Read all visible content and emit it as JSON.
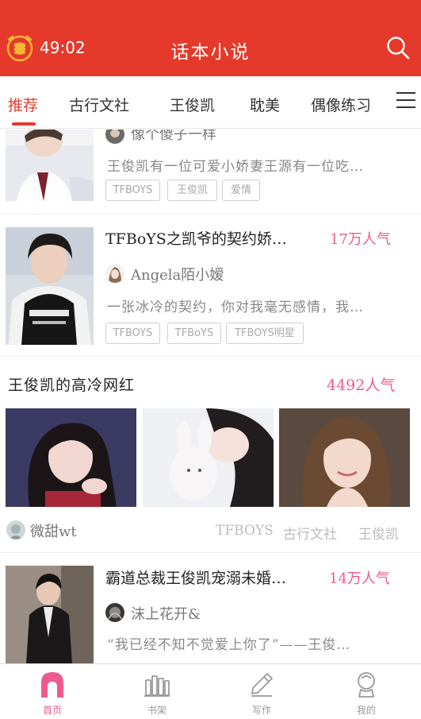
{
  "header": {
    "timer": "49:02",
    "title": "话本小说"
  },
  "tabs": [
    {
      "label": "推荐",
      "active": true
    },
    {
      "label": "古行文社"
    },
    {
      "label": "王俊凯"
    },
    {
      "label": "耽美"
    },
    {
      "label": "偶像练习"
    }
  ],
  "books": [
    {
      "author": "像个傻子一样",
      "summary": "王俊凯有一位可爱小娇妻王源有一位吃…",
      "tags": [
        "TFBOYS",
        "王俊凯",
        "爱情"
      ]
    },
    {
      "title": "TFBoYS之凯爷的契约娇…",
      "popularity": "17万人气",
      "author": "Angela陌小嫒",
      "summary": "一张冰冷的契约，你对我毫无感情，我…",
      "tags": [
        "TFBOYS",
        "TFBoYS",
        "TFBOYS明星"
      ]
    },
    {
      "title": "霸道总裁王俊凯宠溺未婚…",
      "popularity": "14万人气",
      "author": "沫上花开&",
      "summary": "“我已经不知不觉爱上你了”——王俊…"
    }
  ],
  "collection": {
    "title": "王俊凯的高冷网红",
    "popularity": "4492人气",
    "curator": "微甜wt",
    "tags": [
      "TFBOYS",
      "古行文社",
      "王俊凯"
    ]
  },
  "bottom_nav": [
    {
      "label": "首页",
      "icon": "home-icon",
      "active": true
    },
    {
      "label": "书架",
      "icon": "bookshelf-icon"
    },
    {
      "label": "写作",
      "icon": "pen-icon"
    },
    {
      "label": "我的",
      "icon": "profile-icon"
    }
  ],
  "colors": {
    "brand_red": "#e53a2b",
    "accent_pink": "#ee5a8f"
  }
}
